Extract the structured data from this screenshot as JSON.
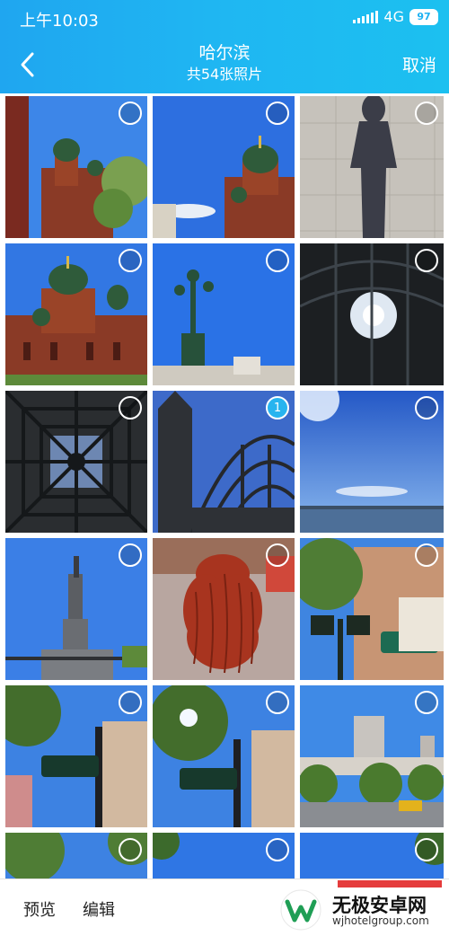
{
  "status_bar": {
    "time": "上午10:03",
    "network": "4G",
    "battery": "97"
  },
  "header": {
    "title": "哈尔滨",
    "subtitle": "共54张照片",
    "cancel_label": "取消"
  },
  "photos": [
    {
      "name": "photo-cathedral-1",
      "subject": "St. Sophia Cathedral with tree",
      "selected": false
    },
    {
      "name": "photo-cathedral-2",
      "subject": "St. Sophia Cathedral domes",
      "selected": false
    },
    {
      "name": "photo-shadow",
      "subject": "person shadow on pavement",
      "selected": false
    },
    {
      "name": "photo-cathedral-3",
      "subject": "St. Sophia Cathedral front",
      "selected": false
    },
    {
      "name": "photo-streetlamp",
      "subject": "street lamp against sky",
      "selected": false
    },
    {
      "name": "photo-ironwork-1",
      "subject": "iron pavilion with sun",
      "selected": false
    },
    {
      "name": "photo-ironwork-2",
      "subject": "iron dome ceiling",
      "selected": false
    },
    {
      "name": "photo-ironwork-3",
      "subject": "tower and iron arches",
      "selected": true,
      "index": "1"
    },
    {
      "name": "photo-river",
      "subject": "sky over river",
      "selected": false
    },
    {
      "name": "photo-monument",
      "subject": "flood control monument",
      "selected": false
    },
    {
      "name": "photo-sausages",
      "subject": "hanging red sausages",
      "selected": false
    },
    {
      "name": "photo-street-sign",
      "subject": "lamp and street sign",
      "selected": false
    },
    {
      "name": "photo-street-1",
      "subject": "street sign with trees",
      "selected": false
    },
    {
      "name": "photo-street-2",
      "subject": "street sign, sunlit trees",
      "selected": false
    },
    {
      "name": "photo-city",
      "subject": "city skyline",
      "selected": false
    },
    {
      "name": "photo-partial-1",
      "subject": "trees partial",
      "selected": false
    },
    {
      "name": "photo-partial-2",
      "subject": "sky partial",
      "selected": false
    },
    {
      "name": "photo-partial-3",
      "subject": "sky partial",
      "selected": false
    }
  ],
  "bottom_bar": {
    "preview_label": "预览",
    "edit_label": "编辑"
  },
  "watermark": {
    "title": "无极安卓网",
    "url": "wjhotelgroup.com"
  },
  "colors": {
    "header_gradient_start": "#1fa6f0",
    "header_gradient_end": "#1cc0f0",
    "selected_badge": "#27b4ef",
    "confirm_strip": "#e53c3c"
  }
}
